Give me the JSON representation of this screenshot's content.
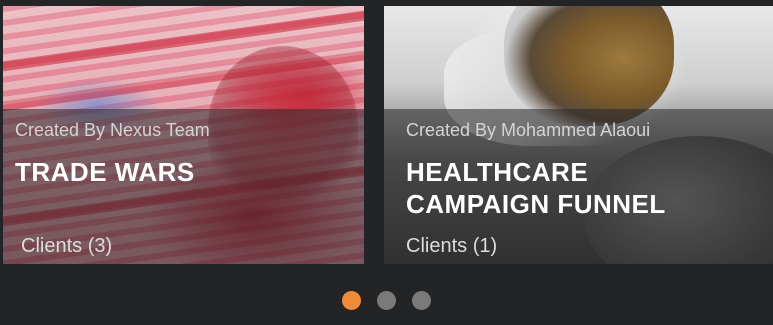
{
  "cards": [
    {
      "creator": "Created By Nexus Team",
      "title": "TRADE WARS",
      "clients": "Clients (3)"
    },
    {
      "creator": "Created By Mohammed Alaoui",
      "title": "HEALTHCARE CAMPAIGN FUNNEL",
      "clients": "Clients (1)"
    }
  ],
  "pagination": {
    "count": 3,
    "active_index": 0,
    "active_color": "#f08b3a",
    "inactive_color": "#7a7a7a"
  }
}
